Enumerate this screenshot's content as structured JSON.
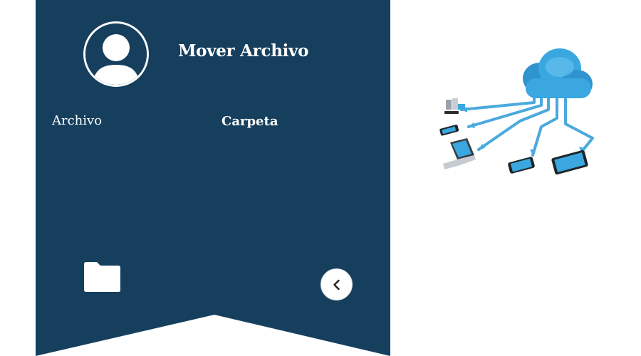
{
  "header": {
    "title": "Mover Archivo"
  },
  "labels": {
    "file": "Archivo",
    "folder": "Carpeta"
  },
  "icons": {
    "avatar": "user-avatar-icon",
    "folder": "folder-icon",
    "back": "chevron-left-icon",
    "illustration": "cloud-network-illustration"
  },
  "colors": {
    "panel": "#163f5e",
    "text": "#ffffff",
    "cloud": "#3aa7e0"
  }
}
